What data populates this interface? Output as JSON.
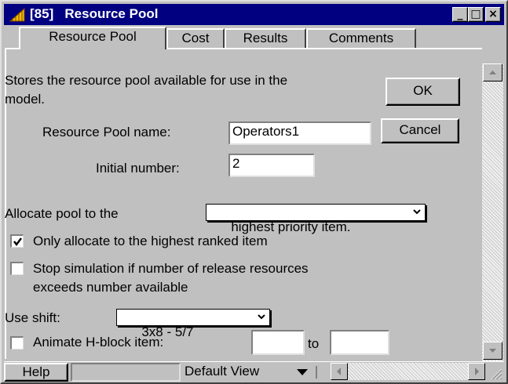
{
  "window": {
    "title": "[85]   Resource Pool",
    "icon": "extend-block-icon"
  },
  "titlebar_buttons": {
    "minimize": "_",
    "maximize": "□",
    "close": "×"
  },
  "tabs": [
    {
      "label": "Resource Pool",
      "active": true
    },
    {
      "label": "Cost",
      "active": false
    },
    {
      "label": "Results",
      "active": false
    },
    {
      "label": "Comments",
      "active": false
    }
  ],
  "description": {
    "line1": "Stores the resource pool available for use in the",
    "line2": "model."
  },
  "buttons": {
    "ok": "OK",
    "cancel": "Cancel"
  },
  "form": {
    "pool_name_label": "Resource Pool name:",
    "pool_name_value": "Operators1",
    "initial_number_label": "Initial number:",
    "initial_number_value": "2",
    "allocate_label": "Allocate pool to the",
    "allocate_value": "highest priority item.",
    "only_allocate_label": "Only allocate to the highest ranked item",
    "only_allocate_checked": true,
    "stop_sim_label_line1": "Stop simulation if number of release resources",
    "stop_sim_label_line2": "exceeds number available",
    "stop_sim_checked": false,
    "use_shift_label": "Use shift:",
    "use_shift_value": "3x8 - 5/7",
    "animate_label": "Animate H-block item:",
    "animate_checked": false,
    "animate_from_value": "",
    "to_label": "to",
    "animate_to_value": ""
  },
  "statusbar": {
    "help_label": "Help",
    "help_field_value": "",
    "view_label": "Default View"
  },
  "colors": {
    "titlebar": "#000080",
    "face": "#c0c0c0"
  }
}
